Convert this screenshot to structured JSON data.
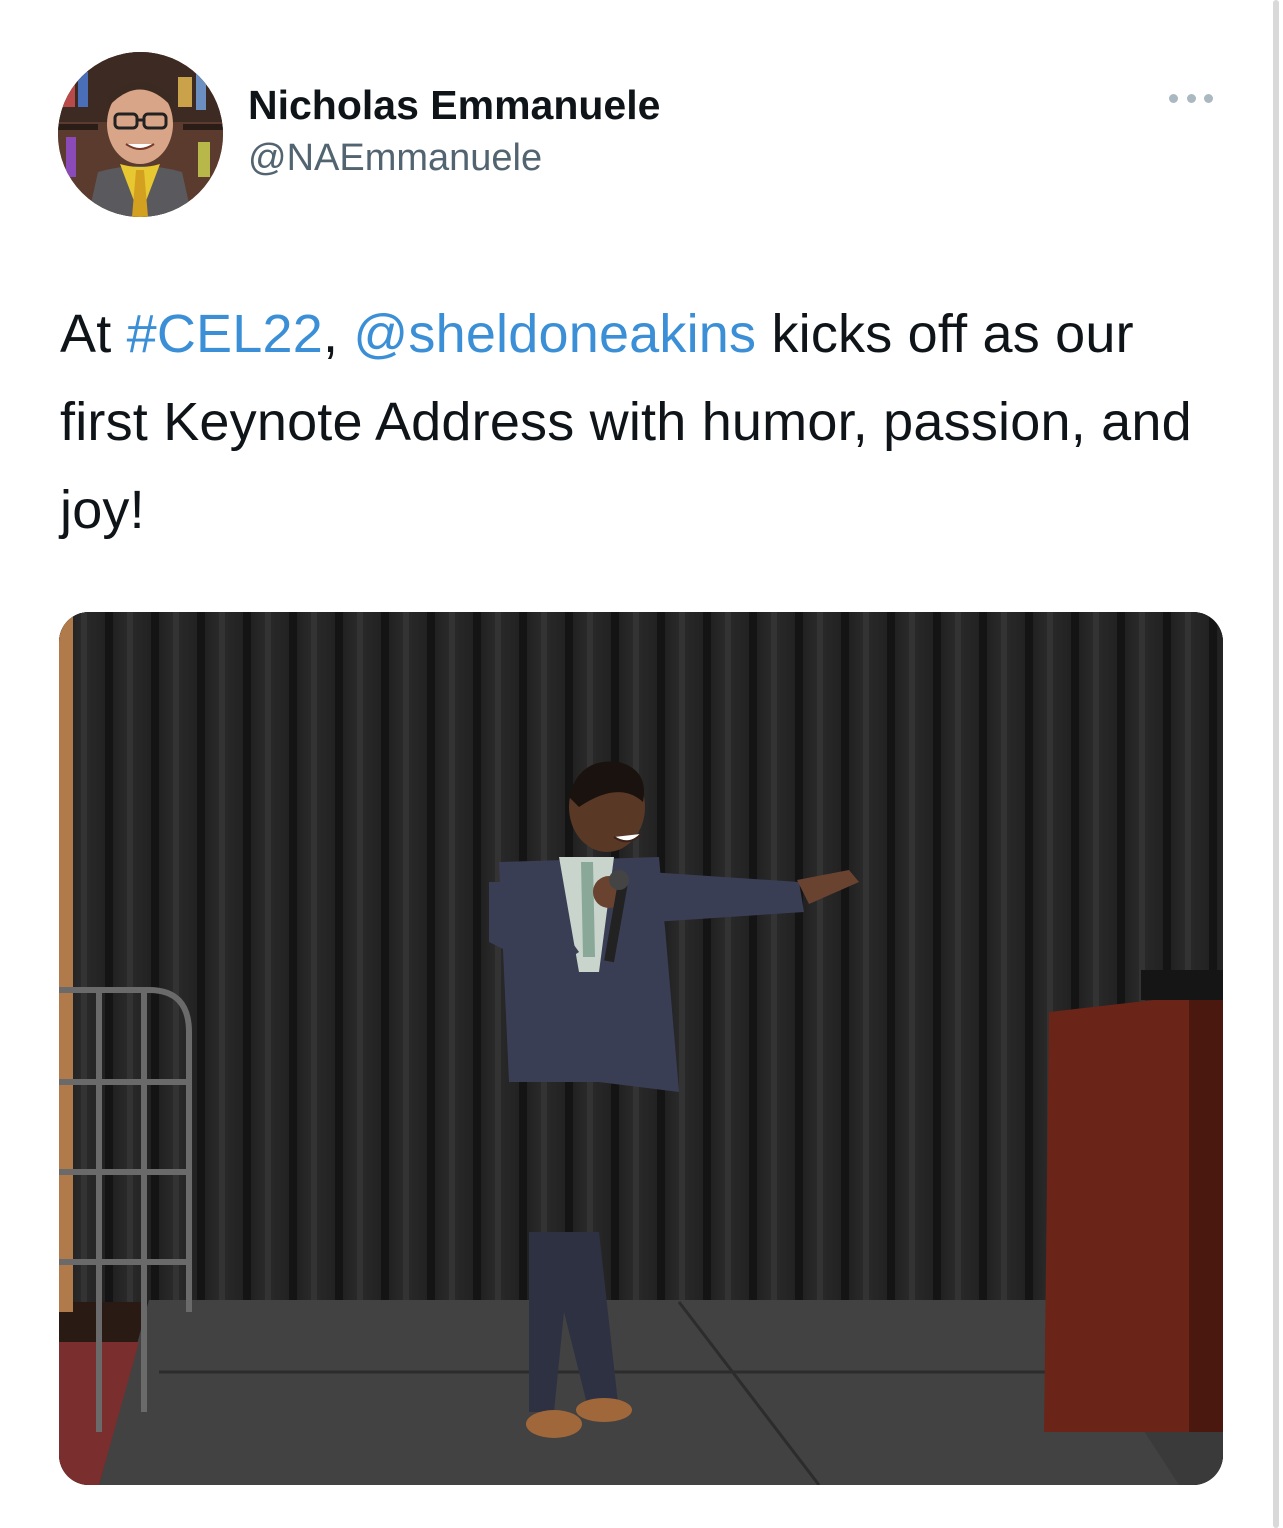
{
  "author": {
    "display_name": "Nicholas Emmanuele",
    "handle": "@NAEmmanuele",
    "avatar_icon": "profile-photo"
  },
  "menu": {
    "more_icon": "more-horizontal-icon"
  },
  "tweet": {
    "segments": [
      {
        "text": "At ",
        "type": "plain"
      },
      {
        "text": "#CEL22",
        "type": "hashtag"
      },
      {
        "text": ", ",
        "type": "plain"
      },
      {
        "text": "@sheldoneakins",
        "type": "mention"
      },
      {
        "text": " kicks off as our first Keynote Address with humor, passion, and joy!",
        "type": "plain"
      }
    ]
  },
  "media": {
    "kind": "photo",
    "icon": "photo-speaker-on-stage"
  },
  "colors": {
    "link": "#3b8fd6",
    "text": "#0f1419",
    "secondary": "#536471"
  }
}
